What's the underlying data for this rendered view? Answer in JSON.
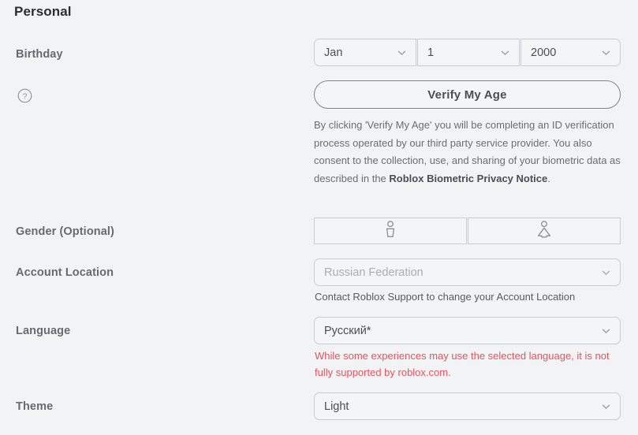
{
  "section": {
    "title": "Personal"
  },
  "birthday": {
    "label": "Birthday",
    "month": "Jan",
    "day": "1",
    "year": "2000",
    "chevron_icon": "chevron-down-icon"
  },
  "verify_age": {
    "button_label": "Verify My Age",
    "help_icon": "help-circle-icon",
    "disclaimer_part1": "By clicking 'Verify My Age' you will be completing an ID verification process operated by our third party service provider. You also consent to the collection, use, and sharing of your biometric data as described in the ",
    "disclaimer_bold": "Roblox Biometric Privacy Notice",
    "disclaimer_part2": "."
  },
  "gender": {
    "label": "Gender (Optional)",
    "male_icon": "male-gender-icon",
    "female_icon": "female-gender-icon"
  },
  "account_location": {
    "label": "Account Location",
    "value": "Russian Federation",
    "note": "Contact Roblox Support to change your Account Location"
  },
  "language": {
    "label": "Language",
    "value": "Русский*",
    "warning": "While some experiences may use the selected language, it is not fully supported by roblox.com."
  },
  "theme": {
    "label": "Theme",
    "value": "Light"
  },
  "colors": {
    "page_background": "#f2f3f5",
    "field_background": "#f4f5f6",
    "field_border": "#c9cdd1",
    "label_text": "#666b70",
    "warning_text": "#e8525f",
    "heading_text": "#2c2d2f"
  }
}
